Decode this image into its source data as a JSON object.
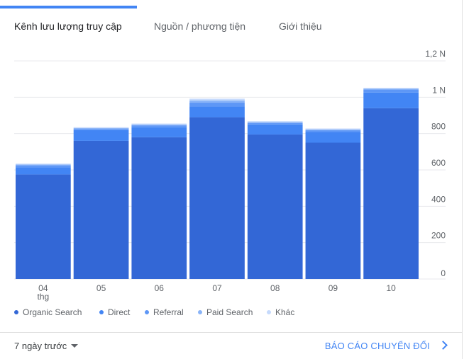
{
  "tabs": [
    {
      "label": "Kênh lưu lượng truy cập",
      "active": true
    },
    {
      "label": "Nguồn / phương tiện",
      "active": false
    },
    {
      "label": "Giới thiệu",
      "active": false
    }
  ],
  "chart_data": {
    "type": "bar",
    "stacked": true,
    "categories": [
      "04",
      "05",
      "06",
      "07",
      "08",
      "09",
      "10"
    ],
    "category_sublabels": [
      "thg",
      "",
      "",
      "",
      "",
      "",
      ""
    ],
    "series": [
      {
        "name": "Organic Search",
        "color": "#3367d6",
        "values": [
          575,
          760,
          780,
          890,
          795,
          750,
          940
        ]
      },
      {
        "name": "Direct",
        "color": "#4285f4",
        "values": [
          40,
          60,
          55,
          60,
          55,
          60,
          85
        ]
      },
      {
        "name": "Referral",
        "color": "#5e97f6",
        "values": [
          10,
          5,
          10,
          20,
          8,
          8,
          17
        ]
      },
      {
        "name": "Paid Search",
        "color": "#8ab4f8",
        "values": [
          5,
          5,
          5,
          12,
          5,
          5,
          5
        ]
      },
      {
        "name": "Khác",
        "color": "#c6dafc",
        "values": [
          5,
          5,
          5,
          10,
          5,
          5,
          5
        ]
      }
    ],
    "y_ticks": [
      {
        "value": 1200,
        "label": "1,2 N"
      },
      {
        "value": 1000,
        "label": "1 N"
      },
      {
        "value": 800,
        "label": "800"
      },
      {
        "value": 600,
        "label": "600"
      },
      {
        "value": 400,
        "label": "400"
      },
      {
        "value": 200,
        "label": "200"
      },
      {
        "value": 0,
        "label": "0"
      }
    ],
    "ylim": [
      0,
      1200
    ],
    "grid": true,
    "legend_position": "bottom"
  },
  "legend": [
    {
      "label": "Organic Search",
      "color": "#3367d6"
    },
    {
      "label": "Direct",
      "color": "#4285f4"
    },
    {
      "label": "Referral",
      "color": "#5e97f6"
    },
    {
      "label": "Paid Search",
      "color": "#8ab4f8"
    },
    {
      "label": "Khác",
      "color": "#c6dafc"
    }
  ],
  "footer": {
    "date_range": "7 ngày trước",
    "report_link": "BÁO CÁO CHUYỂN ĐỔI"
  }
}
